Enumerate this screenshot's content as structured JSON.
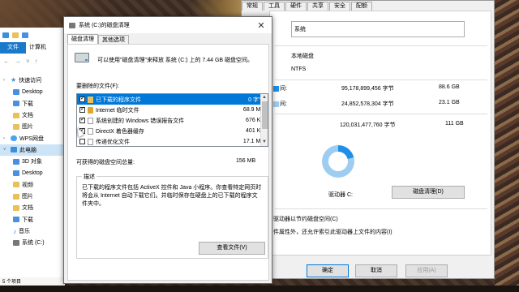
{
  "explorer": {
    "tabs": [
      "文件",
      "计算机"
    ],
    "nav_items": [
      {
        "label": "快速访问",
        "icon": "star-icon",
        "indent": false
      },
      {
        "label": "Desktop",
        "icon": "desktop-folder-icon",
        "indent": true
      },
      {
        "label": "下载",
        "icon": "download-icon",
        "indent": true
      },
      {
        "label": "文档",
        "icon": "document-icon",
        "indent": true
      },
      {
        "label": "图片",
        "icon": "picture-icon",
        "indent": true
      },
      {
        "label": "WPS网盘",
        "icon": "cloud-icon",
        "indent": false
      },
      {
        "label": "此电脑",
        "icon": "pc-icon",
        "indent": false,
        "selected": true
      },
      {
        "label": "3D 对象",
        "icon": "3d-objects-icon",
        "indent": true
      },
      {
        "label": "Desktop",
        "icon": "desktop-folder-icon",
        "indent": true
      },
      {
        "label": "视频",
        "icon": "video-icon",
        "indent": true
      },
      {
        "label": "图片",
        "icon": "picture-icon",
        "indent": true
      },
      {
        "label": "文档",
        "icon": "document-icon",
        "indent": true
      },
      {
        "label": "下载",
        "icon": "download-icon",
        "indent": true
      },
      {
        "label": "音乐",
        "icon": "music-icon",
        "indent": true
      },
      {
        "label": "系统 (C:)",
        "icon": "drive-icon",
        "indent": true
      }
    ],
    "status": "5 个项目"
  },
  "properties": {
    "tabs": [
      "常规",
      "工具",
      "硬件",
      "共享",
      "安全",
      "配额"
    ],
    "name_value": "系统",
    "type_value": "本地磁盘",
    "fs_value": "NTFS",
    "used_prefix": "间:",
    "used_bytes": "95,178,899,456 字节",
    "used_size": "88.6 GB",
    "free_prefix": "间:",
    "free_bytes": "24,852,578,304 字节",
    "free_size": "23.1 GB",
    "capacity_bytes": "120,031,477,760 字节",
    "capacity_size": "111 GB",
    "drive_label": "驱动器 C:",
    "used_fraction": 0.79,
    "cleanup_button": "磁盘清理(D)",
    "compress_text": "驱动器以节约磁盘空间(C)",
    "index_text": "件属性外，还允许索引此驱动器上文件的内容(I)",
    "ok_button": "确定",
    "cancel_button": "取消",
    "apply_button": "应用(A)"
  },
  "dialog": {
    "title": "系统 (C:)的磁盘清理",
    "close_glyph": "✕",
    "tabs": [
      "磁盘清理",
      "其他选项"
    ],
    "intro": "可以使用\"磁盘清理\"来释放 系统 (C:) 上的 7.44 GB 磁盘空间。",
    "files_label": "要删除的文件(F):",
    "files": [
      {
        "name": "已下载的程序文件",
        "size": "0 字节",
        "checked": true,
        "selected": true,
        "icon": "folder"
      },
      {
        "name": "Internet 临时文件",
        "size": "68.9 MB",
        "checked": true,
        "selected": false,
        "icon": "lock"
      },
      {
        "name": "系统创建的 Windows 错误报告文件",
        "size": "676 KB",
        "checked": true,
        "selected": false,
        "icon": "page"
      },
      {
        "name": "DirectX 着色器缓存",
        "size": "401 KB",
        "checked": true,
        "selected": false,
        "icon": "page"
      },
      {
        "name": "传递优化文件",
        "size": "17.1 MB",
        "checked": false,
        "selected": false,
        "icon": "page"
      }
    ],
    "total_label": "可获得的磁盘空间总量:",
    "total_value": "156 MB",
    "desc_title": "描述",
    "desc_text": "已下载的程序文件包括 ActiveX 控件和 Java 小程序。你查看特定网页时将会从 Internet 自动下载它们。并临时保存在硬盘上的已下载的程序文件夹中。",
    "view_files_button": "查看文件(V)"
  },
  "colors": {
    "accent": "#0078d7",
    "file_tab": "#1979ca",
    "donut_used": "#1e90e8",
    "donut_free": "#9ecdf1"
  }
}
